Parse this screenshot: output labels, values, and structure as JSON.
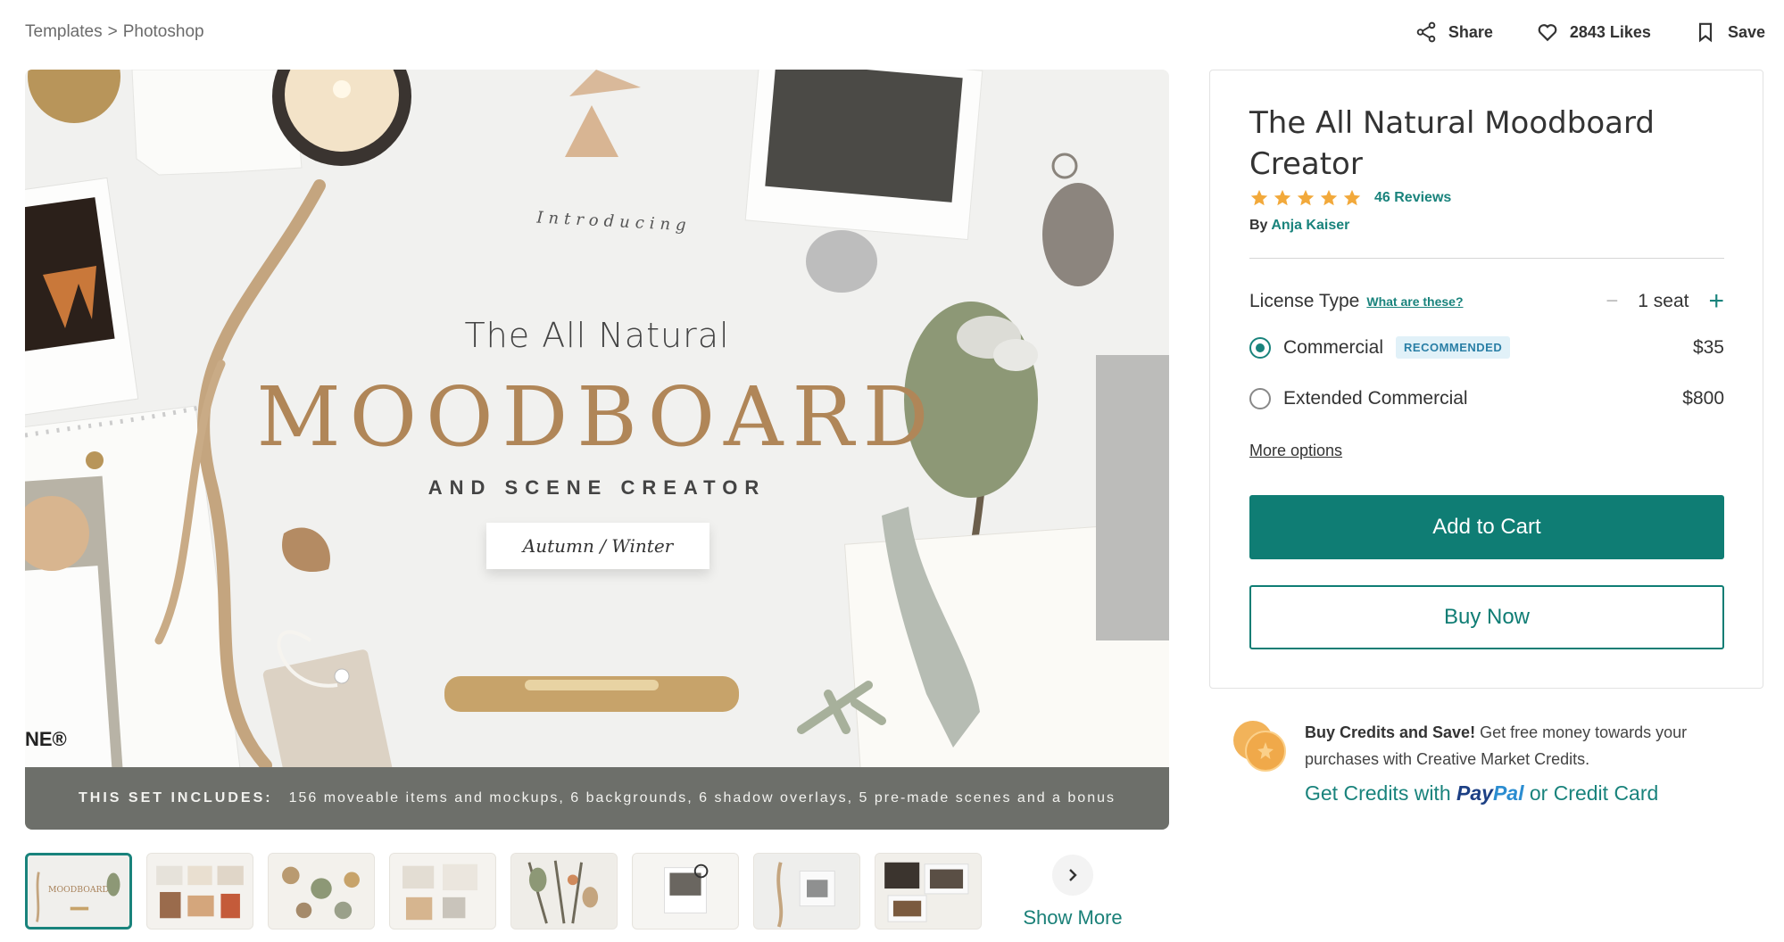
{
  "breadcrumb": {
    "parent": "Templates",
    "separator": ">",
    "current": "Photoshop"
  },
  "top_actions": {
    "share": "Share",
    "likes": "2843 Likes",
    "save": "Save"
  },
  "hero": {
    "introducing": "Introducing",
    "line1": "The All Natural",
    "line2": "MOODBOARD",
    "line3": "AND SCENE CREATOR",
    "season": "Autumn / Winter",
    "caption_lead": "THIS SET INCLUDES:",
    "caption_text": "156 moveable items and mockups, 6 backgrounds, 6 shadow overlays, 5 pre-made scenes and a bonus",
    "logo_fragment": "NE®"
  },
  "thumbnails": {
    "count": 8,
    "active_index": 0,
    "thumb1_title": "MOODBOARD"
  },
  "show_more": "Show More",
  "product": {
    "title": "The All Natural Moodboard Creator",
    "rating": 5,
    "reviews": "46 Reviews",
    "by_label": "By",
    "author": "Anja Kaiser",
    "license_label": "License Type",
    "license_help": "What are these?",
    "seat_minus": "−",
    "seats": "1 seat",
    "seat_plus": "+",
    "options": [
      {
        "label": "Commercial",
        "badge": "RECOMMENDED",
        "price": "$35",
        "selected": true
      },
      {
        "label": "Extended Commercial",
        "price": "$800",
        "selected": false
      }
    ],
    "more_options": "More options",
    "add_to_cart": "Add to Cart",
    "buy_now": "Buy Now"
  },
  "credits": {
    "headline": "Buy Credits and Save!",
    "body": "Get free money towards your purchases with Creative Market Credits.",
    "link_prefix": "Get Credits with",
    "paypal_a": "Pay",
    "paypal_b": "Pal",
    "link_suffix": "or Credit Card"
  },
  "colors": {
    "accent": "#0f7d74",
    "star": "#f2a93b",
    "badge_bg": "#e1f1f8",
    "badge_text": "#2a7fa6",
    "caption_bg": "#6d6f6a"
  }
}
